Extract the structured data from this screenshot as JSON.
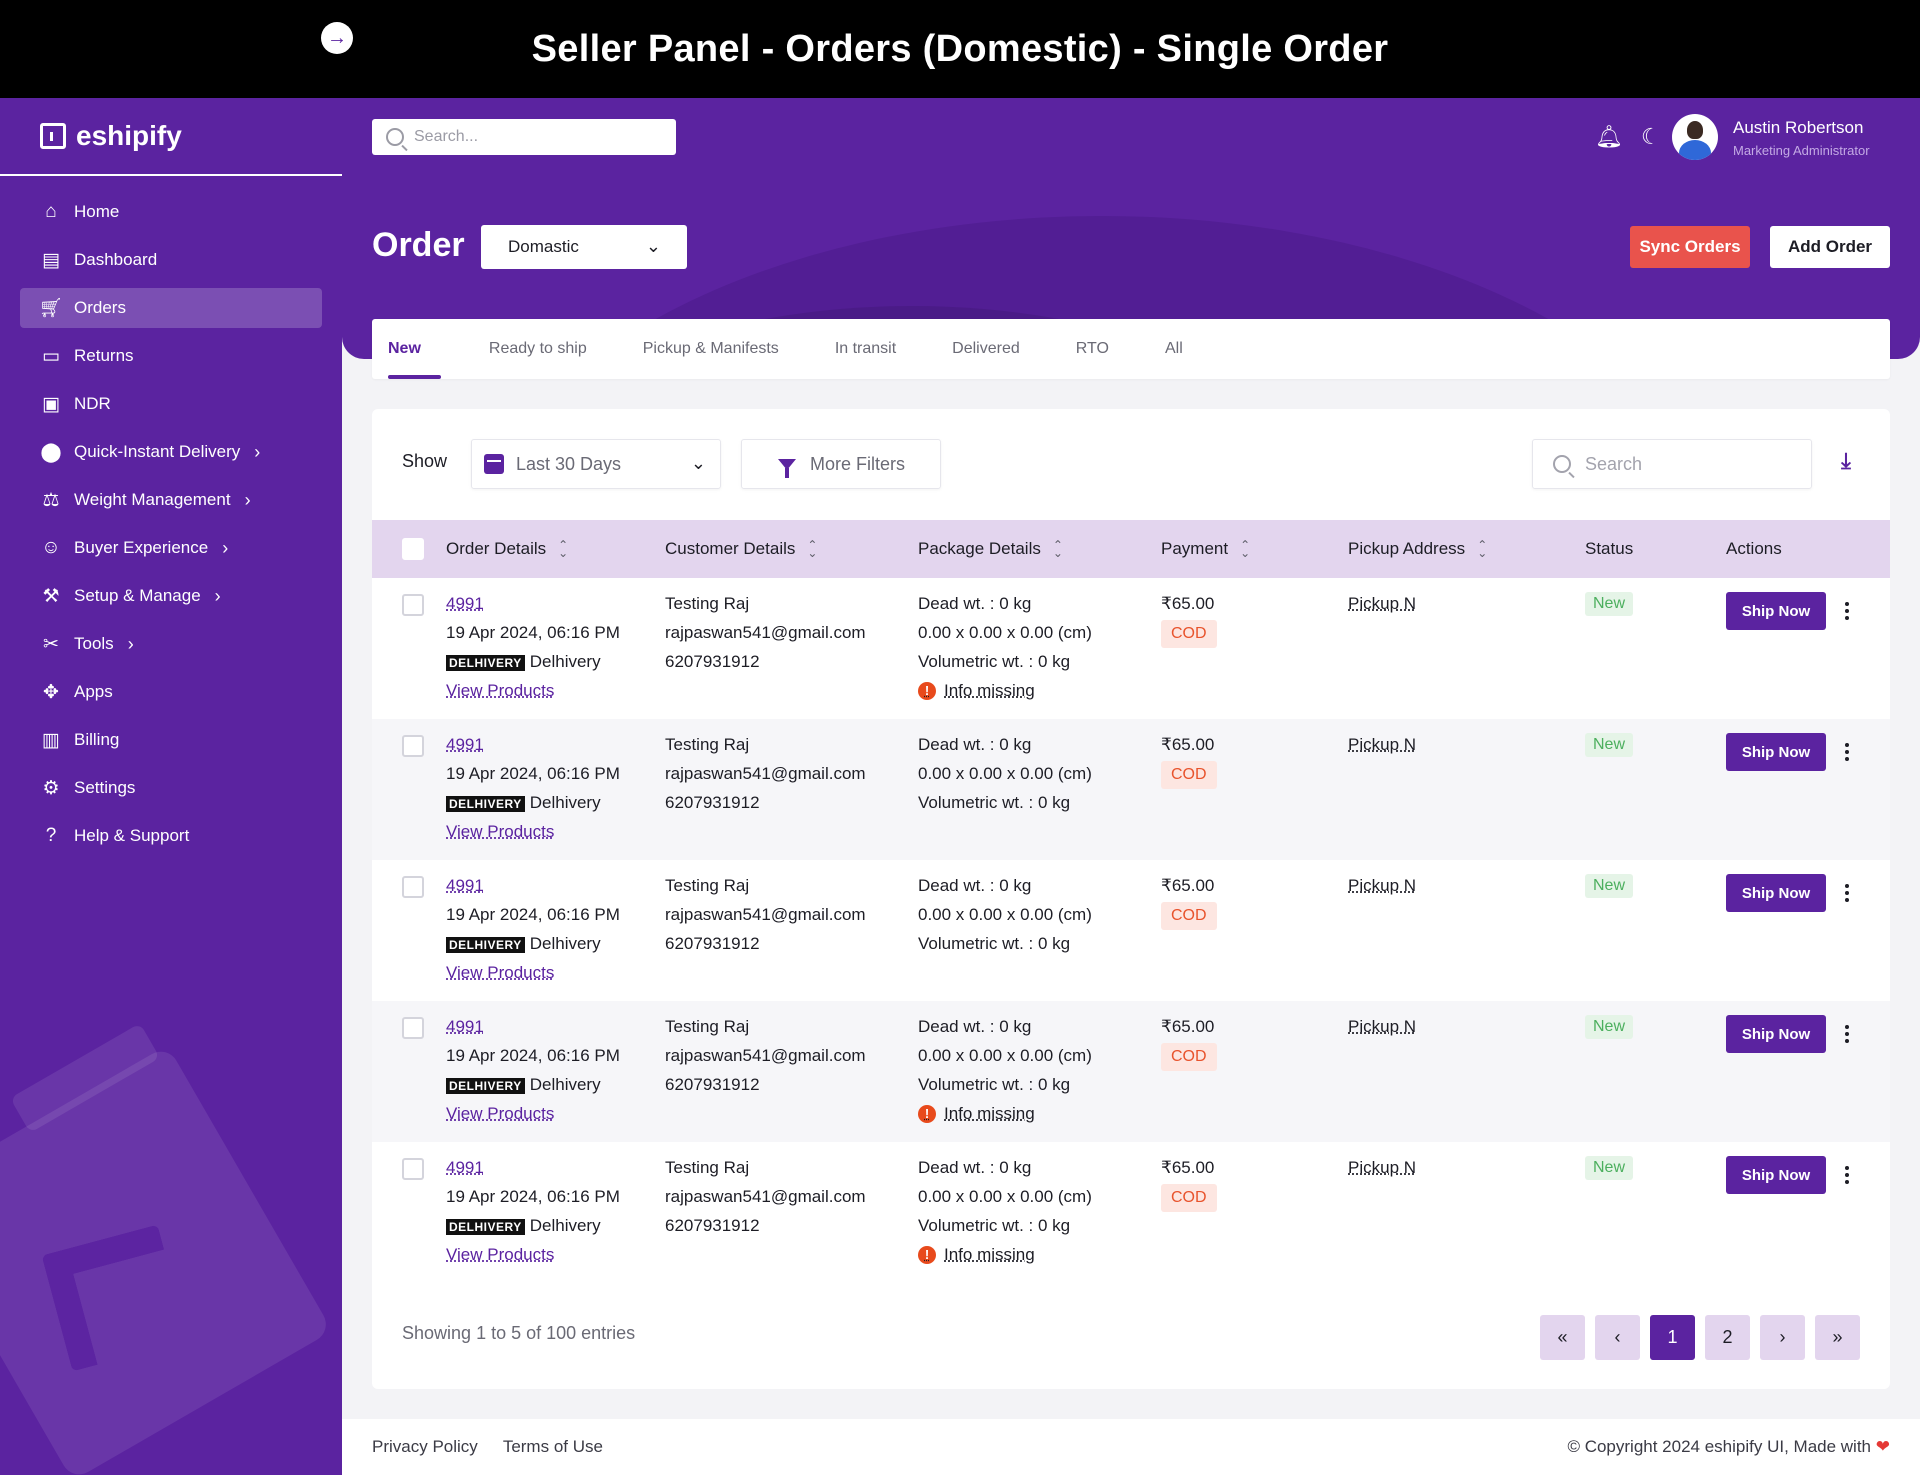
{
  "banner": {
    "title": "Seller Panel - Orders (Domestic) - Single Order"
  },
  "brand": {
    "name": "eshipify"
  },
  "sidebar": {
    "items": [
      {
        "label": "Home",
        "icon": "home-icon"
      },
      {
        "label": "Dashboard",
        "icon": "dashboard-icon"
      },
      {
        "label": "Orders",
        "icon": "cart-icon",
        "active": true
      },
      {
        "label": "Returns",
        "icon": "returns-icon"
      },
      {
        "label": "NDR",
        "icon": "ndr-icon"
      },
      {
        "label": "Quick-Instant Delivery",
        "icon": "location-pin-icon",
        "chevron": true
      },
      {
        "label": "Weight Management",
        "icon": "weight-icon",
        "chevron": true
      },
      {
        "label": "Buyer Experience",
        "icon": "buyer-icon",
        "chevron": true
      },
      {
        "label": "Setup & Manage",
        "icon": "setup-icon",
        "chevron": true
      },
      {
        "label": "Tools",
        "icon": "tools-icon",
        "chevron": true
      },
      {
        "label": "Apps",
        "icon": "apps-icon"
      },
      {
        "label": "Billing",
        "icon": "billing-icon"
      },
      {
        "label": "Settings",
        "icon": "gear-icon"
      },
      {
        "label": "Help & Support",
        "icon": "help-icon"
      }
    ]
  },
  "topbar": {
    "search_placeholder": "Search...",
    "user": {
      "name": "Austin Robertson",
      "role": "Marketing Administrator"
    }
  },
  "header": {
    "title": "Order",
    "type_select": "Domastic",
    "sync_label": "Sync Orders",
    "add_label": "Add Order"
  },
  "tabs": [
    {
      "label": "New",
      "active": true
    },
    {
      "label": "Ready to ship"
    },
    {
      "label": "Pickup & Manifests"
    },
    {
      "label": "In transit"
    },
    {
      "label": "Delivered"
    },
    {
      "label": "RTO"
    },
    {
      "label": "All"
    }
  ],
  "filters": {
    "show_label": "Show",
    "date_range": "Last 30 Days",
    "more_filters": "More Filters",
    "search_placeholder": "Search"
  },
  "table": {
    "columns": [
      "Order Details",
      "Customer Details",
      "Package Details",
      "Payment",
      "Pickup Address",
      "Status",
      "Actions"
    ],
    "rows": [
      {
        "order_id": "4991",
        "date": "19 Apr 2024, 06:16 PM",
        "courier_logo": "DELHIVERY",
        "courier": "Delhivery",
        "view_products": "View Products",
        "customer_name": "Testing Raj",
        "email": "rajpaswan541@gmail.com",
        "phone": "6207931912",
        "dead_wt": "Dead wt. : 0 kg",
        "dims": "0.00 x 0.00 x 0.00 (cm)",
        "vol_wt": "Volumetric wt. : 0 kg",
        "info_missing": "Info missing",
        "amount": "₹65.00",
        "payment_mode": "COD",
        "pickup": "Pickup N",
        "status": "New",
        "action": "Ship Now"
      },
      {
        "order_id": "4991",
        "date": "19 Apr 2024, 06:16 PM",
        "courier_logo": "DELHIVERY",
        "courier": "Delhivery",
        "view_products": "View Products",
        "customer_name": "Testing Raj",
        "email": "rajpaswan541@gmail.com",
        "phone": "6207931912",
        "dead_wt": "Dead wt. : 0 kg",
        "dims": "0.00 x 0.00 x 0.00 (cm)",
        "vol_wt": "Volumetric wt. : 0 kg",
        "info_missing": "",
        "amount": "₹65.00",
        "payment_mode": "COD",
        "pickup": "Pickup N",
        "status": "New",
        "action": "Ship Now"
      },
      {
        "order_id": "4991",
        "date": "19 Apr 2024, 06:16 PM",
        "courier_logo": "DELHIVERY",
        "courier": "Delhivery",
        "view_products": "View Products",
        "customer_name": "Testing Raj",
        "email": "rajpaswan541@gmail.com",
        "phone": "6207931912",
        "dead_wt": "Dead wt. : 0 kg",
        "dims": "0.00 x 0.00 x 0.00 (cm)",
        "vol_wt": "Volumetric wt. : 0 kg",
        "info_missing": "",
        "amount": "₹65.00",
        "payment_mode": "COD",
        "pickup": "Pickup N",
        "status": "New",
        "action": "Ship Now"
      },
      {
        "order_id": "4991",
        "date": "19 Apr 2024, 06:16 PM",
        "courier_logo": "DELHIVERY",
        "courier": "Delhivery",
        "view_products": "View Products",
        "customer_name": "Testing Raj",
        "email": "rajpaswan541@gmail.com",
        "phone": "6207931912",
        "dead_wt": "Dead wt. : 0 kg",
        "dims": "0.00 x 0.00 x 0.00 (cm)",
        "vol_wt": "Volumetric wt. : 0 kg",
        "info_missing": "Info missing",
        "amount": "₹65.00",
        "payment_mode": "COD",
        "pickup": "Pickup N",
        "status": "New",
        "action": "Ship Now"
      },
      {
        "order_id": "4991",
        "date": "19 Apr 2024, 06:16 PM",
        "courier_logo": "DELHIVERY",
        "courier": "Delhivery",
        "view_products": "View Products",
        "customer_name": "Testing Raj",
        "email": "rajpaswan541@gmail.com",
        "phone": "6207931912",
        "dead_wt": "Dead wt. : 0 kg",
        "dims": "0.00 x 0.00 x 0.00 (cm)",
        "vol_wt": "Volumetric wt. : 0 kg",
        "info_missing": "Info missing",
        "amount": "₹65.00",
        "payment_mode": "COD",
        "pickup": "Pickup N",
        "status": "New",
        "action": "Ship Now"
      }
    ]
  },
  "pagination": {
    "showing_label": "Showing",
    "showing_text": "1 to 5 of 100 entries",
    "first": "«",
    "prev": "‹",
    "pages": [
      "1",
      "2"
    ],
    "current": "1",
    "next": "›",
    "last": "»"
  },
  "footer": {
    "privacy": "Privacy Policy",
    "terms": "Terms of Use",
    "copyright": "© Copyright 2024 eshipify UI, Made with"
  },
  "colors": {
    "primary": "#5b23a0",
    "sync": "#e9534c",
    "cod": "#e8532c",
    "status_new": "#4caf5e"
  }
}
